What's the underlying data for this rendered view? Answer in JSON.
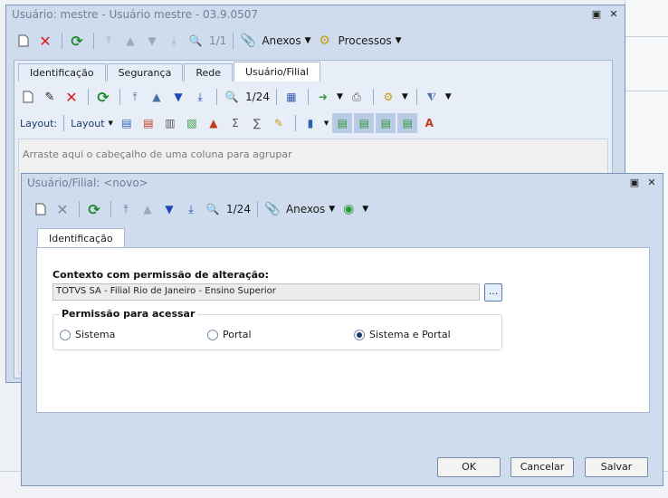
{
  "background_window": {
    "title": "Usuário: mestre - Usuário mestre - 03.9.0507",
    "window_buttons": [
      "▣",
      "✕"
    ],
    "toolbar": {
      "counter": "1/1",
      "attachments_label": "Anexos",
      "processes_label": "Processos"
    },
    "tabs": [
      "Identificação",
      "Segurança",
      "Rede",
      "Usuário/Filial"
    ],
    "grid_toolbar": {
      "counter": "1/24"
    },
    "layout_bar": {
      "layout_label": "Layout:",
      "layout_dropdown": "Layout"
    },
    "group_hint": "Arraste aqui o cabeçalho de uma coluna para agrupar"
  },
  "dialog": {
    "title": "Usuário/Filial: <novo>",
    "window_buttons": [
      "▣",
      "✕"
    ],
    "toolbar": {
      "counter": "1/24",
      "attachments_label": "Anexos"
    },
    "tab": "Identificação",
    "context_label": "Contexto com permissão de alteração:",
    "context_value": "TOTVS SA - Filial Rio de Janeiro - Ensino Superior",
    "browse_button": "...",
    "permission_group": {
      "title": "Permissão para acessar",
      "options": [
        "Sistema",
        "Portal",
        "Sistema e Portal"
      ],
      "selected": "Sistema e Portal"
    },
    "buttons": {
      "ok": "OK",
      "cancel": "Cancelar",
      "save": "Salvar"
    }
  }
}
